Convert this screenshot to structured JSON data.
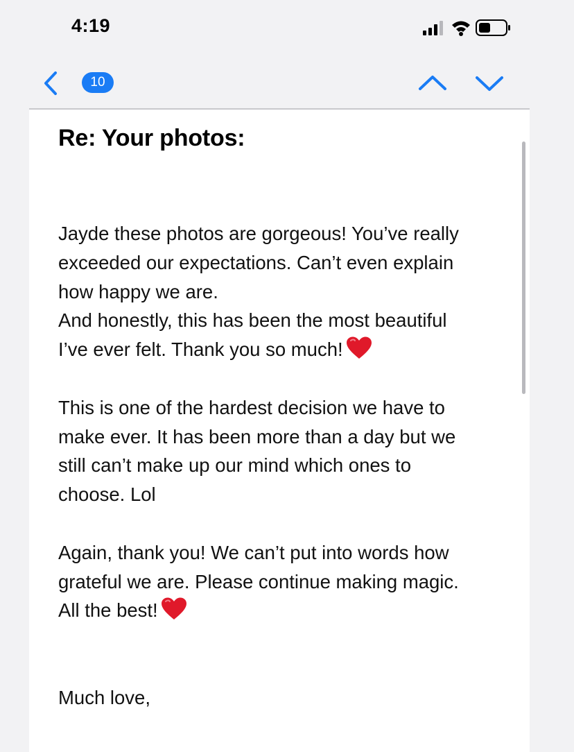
{
  "status_bar": {
    "time": "4:19"
  },
  "nav": {
    "back_icon": "chevron-left-icon",
    "unread_count": "10",
    "prev_icon": "chevron-up-icon",
    "next_icon": "chevron-down-icon",
    "accent_color": "#1a7cf5"
  },
  "email": {
    "subject": "Re: Your photos:",
    "para1_line1": "Jayde these photos are gorgeous! You’ve really",
    "para1_line2": "exceeded our expectations. Can’t even explain",
    "para1_line3": "how happy we are.",
    "para1_line4": "And honestly, this has been the most beautiful",
    "para1_line5": "I’ve ever felt. Thank you so much!",
    "para2_line1": "This is one of the hardest decision we have to",
    "para2_line2": "make ever. It has been more than a day but we",
    "para2_line3": "still can’t make up our mind which ones to",
    "para2_line4": "choose. Lol",
    "para3_line1": "Again, thank you! We can’t put into words how",
    "para3_line2": "grateful we are. Please continue making magic.",
    "para3_line3": "All the best!",
    "closing": "Much love,",
    "heart_icon": "red-heart-icon"
  }
}
